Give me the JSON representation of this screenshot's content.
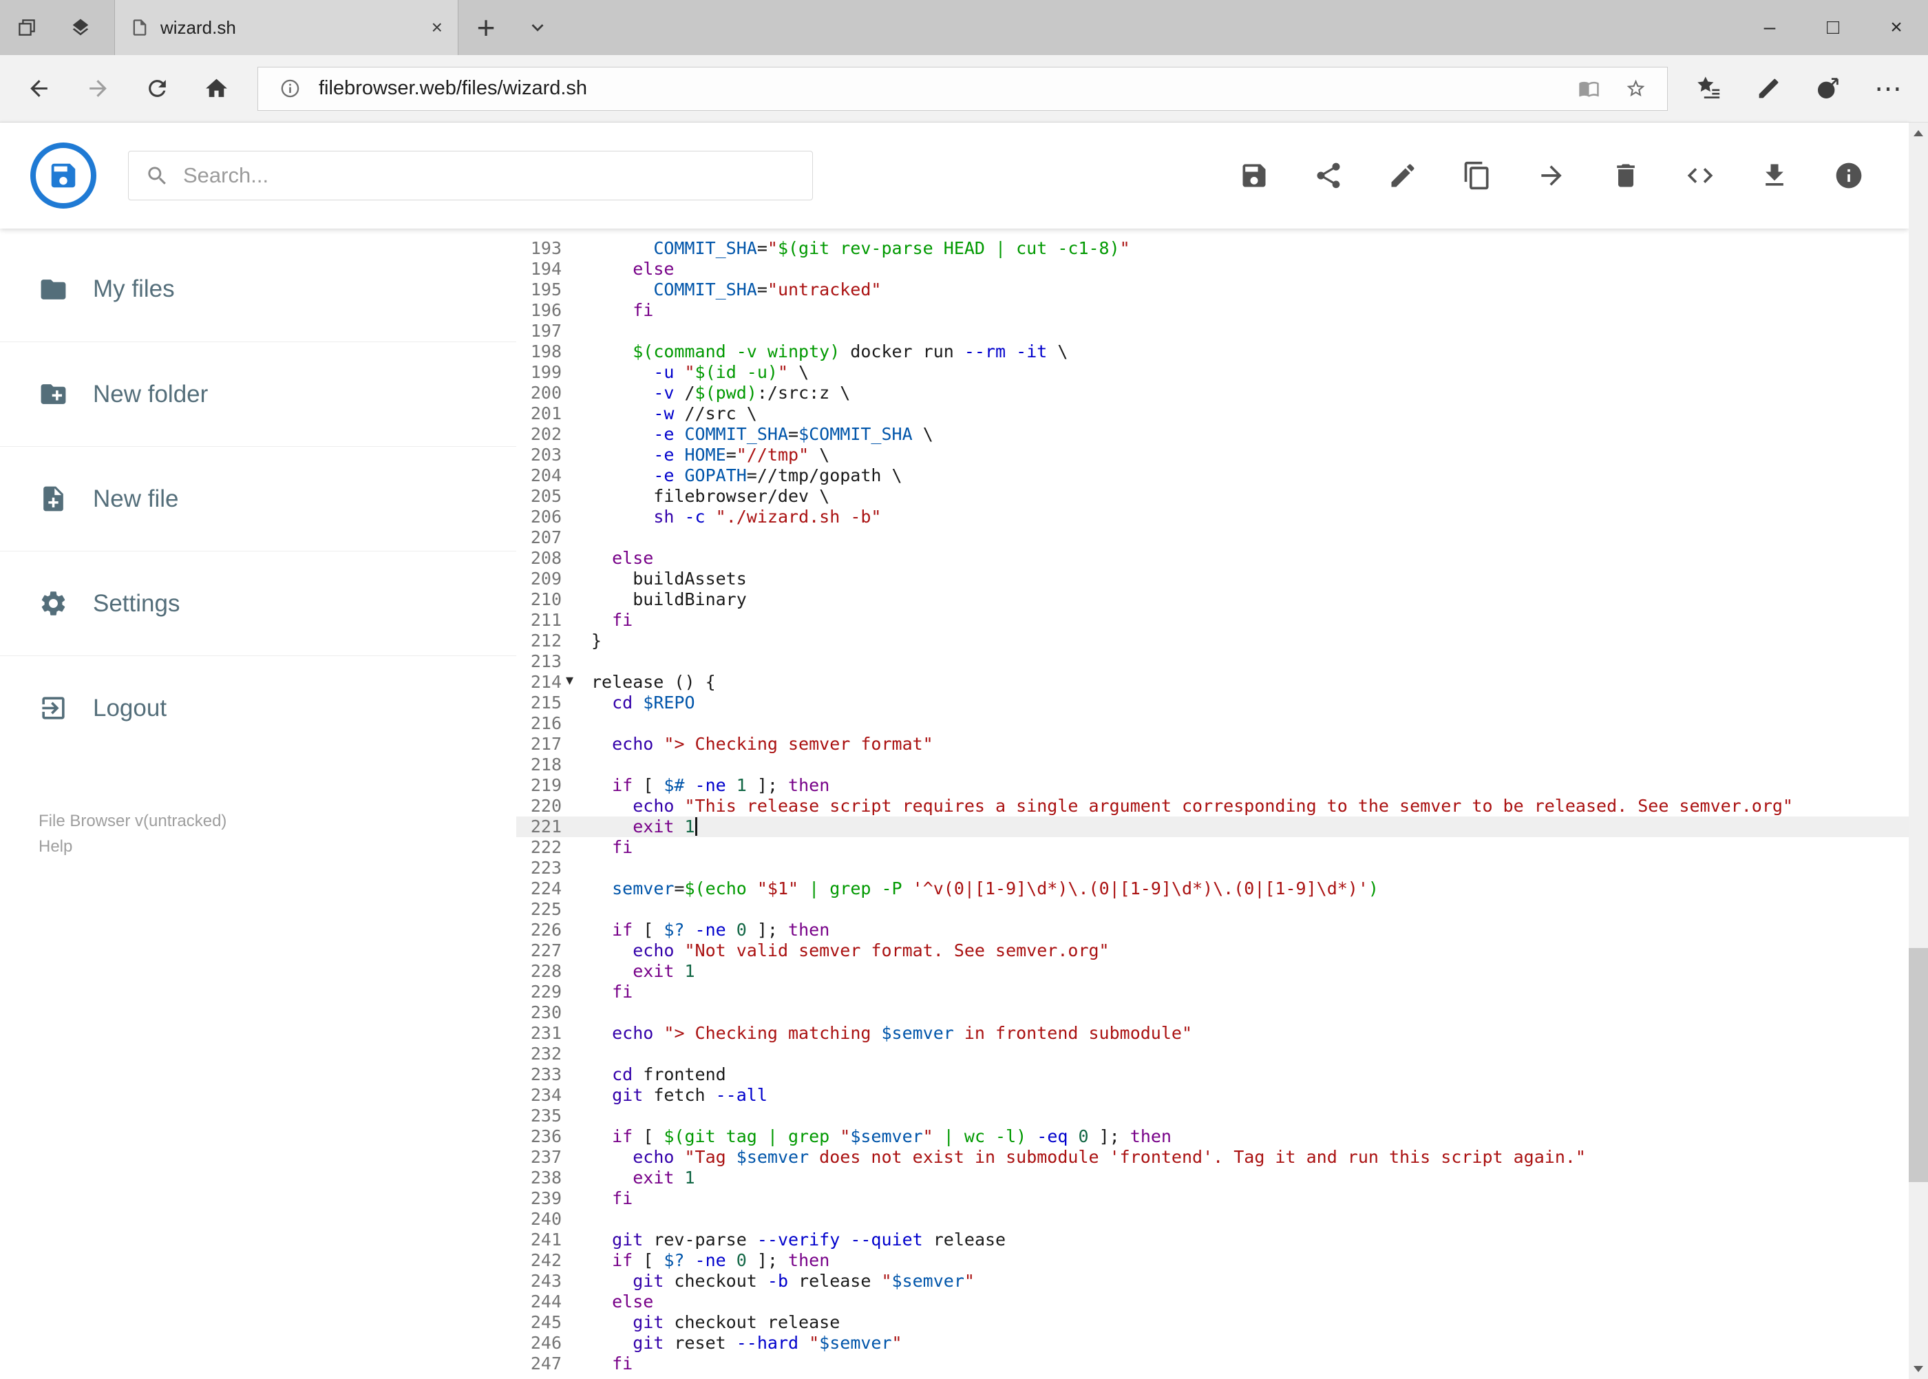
{
  "icons": {
    "close": "×",
    "plus": "+",
    "more": "⋯",
    "minimize": "–",
    "maximize": "□",
    "fold": "▾"
  },
  "browser": {
    "tab": {
      "title": "wizard.sh"
    },
    "address": {
      "host": "filebrowser.web",
      "path": "/files/wizard.sh"
    }
  },
  "app": {
    "search_placeholder": "Search...",
    "sidebar": {
      "items": [
        {
          "label": "My files"
        },
        {
          "label": "New folder"
        },
        {
          "label": "New file"
        },
        {
          "label": "Settings"
        },
        {
          "label": "Logout"
        }
      ],
      "footer_version": "File Browser v(untracked)",
      "footer_help": "Help"
    }
  },
  "editor": {
    "active_line": 221,
    "cursor_line": 221,
    "fold_line": 214,
    "colors": {
      "keyword": "#770088",
      "builtin": "#3300aa",
      "variable": "#0055aa",
      "string": "#aa1111",
      "substitution": "#009900",
      "number": "#116644",
      "flag": "#0000cc"
    },
    "lines": [
      {
        "n": 193,
        "s": [
          [
            "p",
            "      "
          ],
          [
            "d",
            "COMMIT_SHA"
          ],
          [
            "p",
            "="
          ],
          [
            "s",
            "\""
          ],
          [
            "q",
            "$(git rev-parse HEAD | cut -c1-8)"
          ],
          [
            "s",
            "\""
          ]
        ]
      },
      {
        "n": 194,
        "s": [
          [
            "p",
            "    "
          ],
          [
            "k",
            "else"
          ]
        ]
      },
      {
        "n": 195,
        "s": [
          [
            "p",
            "      "
          ],
          [
            "d",
            "COMMIT_SHA"
          ],
          [
            "p",
            "="
          ],
          [
            "s",
            "\"untracked\""
          ]
        ]
      },
      {
        "n": 196,
        "s": [
          [
            "p",
            "    "
          ],
          [
            "k",
            "fi"
          ]
        ]
      },
      {
        "n": 197,
        "s": []
      },
      {
        "n": 198,
        "s": [
          [
            "p",
            "    "
          ],
          [
            "q",
            "$(command -v winpty)"
          ],
          [
            "p",
            " docker run "
          ],
          [
            "a",
            "--rm"
          ],
          [
            "p",
            " "
          ],
          [
            "a",
            "-it"
          ],
          [
            "p",
            " \\"
          ]
        ]
      },
      {
        "n": 199,
        "s": [
          [
            "p",
            "      "
          ],
          [
            "a",
            "-u"
          ],
          [
            "p",
            " "
          ],
          [
            "s",
            "\""
          ],
          [
            "q",
            "$(id -u)"
          ],
          [
            "s",
            "\""
          ],
          [
            "p",
            " \\"
          ]
        ]
      },
      {
        "n": 200,
        "s": [
          [
            "p",
            "      "
          ],
          [
            "a",
            "-v"
          ],
          [
            "p",
            " /"
          ],
          [
            "q",
            "$(pwd)"
          ],
          [
            "p",
            ":/src:z \\"
          ]
        ]
      },
      {
        "n": 201,
        "s": [
          [
            "p",
            "      "
          ],
          [
            "a",
            "-w"
          ],
          [
            "p",
            " //src \\"
          ]
        ]
      },
      {
        "n": 202,
        "s": [
          [
            "p",
            "      "
          ],
          [
            "a",
            "-e"
          ],
          [
            "p",
            " "
          ],
          [
            "d",
            "COMMIT_SHA"
          ],
          [
            "p",
            "="
          ],
          [
            "d",
            "$COMMIT_SHA"
          ],
          [
            "p",
            " \\"
          ]
        ]
      },
      {
        "n": 203,
        "s": [
          [
            "p",
            "      "
          ],
          [
            "a",
            "-e"
          ],
          [
            "p",
            " "
          ],
          [
            "d",
            "HOME"
          ],
          [
            "p",
            "="
          ],
          [
            "s",
            "\"//tmp\""
          ],
          [
            "p",
            " \\"
          ]
        ]
      },
      {
        "n": 204,
        "s": [
          [
            "p",
            "      "
          ],
          [
            "a",
            "-e"
          ],
          [
            "p",
            " "
          ],
          [
            "d",
            "GOPATH"
          ],
          [
            "p",
            "=//tmp/gopath \\"
          ]
        ]
      },
      {
        "n": 205,
        "s": [
          [
            "p",
            "      filebrowser/dev \\"
          ]
        ]
      },
      {
        "n": 206,
        "s": [
          [
            "p",
            "      "
          ],
          [
            "b",
            "sh"
          ],
          [
            "p",
            " "
          ],
          [
            "a",
            "-c"
          ],
          [
            "p",
            " "
          ],
          [
            "s",
            "\"./wizard.sh -b\""
          ]
        ]
      },
      {
        "n": 207,
        "s": []
      },
      {
        "n": 208,
        "s": [
          [
            "p",
            "  "
          ],
          [
            "k",
            "else"
          ]
        ]
      },
      {
        "n": 209,
        "s": [
          [
            "p",
            "    buildAssets"
          ]
        ]
      },
      {
        "n": 210,
        "s": [
          [
            "p",
            "    buildBinary"
          ]
        ]
      },
      {
        "n": 211,
        "s": [
          [
            "p",
            "  "
          ],
          [
            "k",
            "fi"
          ]
        ]
      },
      {
        "n": 212,
        "s": [
          [
            "p",
            "}"
          ]
        ]
      },
      {
        "n": 213,
        "s": []
      },
      {
        "n": 214,
        "s": [
          [
            "p",
            "release () {"
          ]
        ]
      },
      {
        "n": 215,
        "s": [
          [
            "p",
            "  "
          ],
          [
            "b",
            "cd"
          ],
          [
            "p",
            " "
          ],
          [
            "d",
            "$REPO"
          ]
        ]
      },
      {
        "n": 216,
        "s": []
      },
      {
        "n": 217,
        "s": [
          [
            "p",
            "  "
          ],
          [
            "b",
            "echo"
          ],
          [
            "p",
            " "
          ],
          [
            "s",
            "\"> Checking semver format\""
          ]
        ]
      },
      {
        "n": 218,
        "s": []
      },
      {
        "n": 219,
        "s": [
          [
            "p",
            "  "
          ],
          [
            "k",
            "if"
          ],
          [
            "p",
            " [ "
          ],
          [
            "d",
            "$#"
          ],
          [
            "p",
            " "
          ],
          [
            "a",
            "-ne"
          ],
          [
            "p",
            " "
          ],
          [
            "m",
            "1"
          ],
          [
            "p",
            " ]; "
          ],
          [
            "k",
            "then"
          ]
        ]
      },
      {
        "n": 220,
        "s": [
          [
            "p",
            "    "
          ],
          [
            "b",
            "echo"
          ],
          [
            "p",
            " "
          ],
          [
            "s",
            "\"This release script requires a single argument corresponding to the semver to be released. See semver.org\""
          ]
        ]
      },
      {
        "n": 221,
        "s": [
          [
            "p",
            "    "
          ],
          [
            "k",
            "exit"
          ],
          [
            "p",
            " "
          ],
          [
            "m",
            "1"
          ]
        ]
      },
      {
        "n": 222,
        "s": [
          [
            "p",
            "  "
          ],
          [
            "k",
            "fi"
          ]
        ]
      },
      {
        "n": 223,
        "s": []
      },
      {
        "n": 224,
        "s": [
          [
            "p",
            "  "
          ],
          [
            "d",
            "semver"
          ],
          [
            "p",
            "="
          ],
          [
            "q",
            "$(echo "
          ],
          [
            "s",
            "\"$1\""
          ],
          [
            "q",
            " | grep -P "
          ],
          [
            "s",
            "'^v(0|[1-9]\\d*)\\.(0|[1-9]\\d*)\\.(0|[1-9]\\d*)'"
          ],
          [
            "q",
            ")"
          ]
        ]
      },
      {
        "n": 225,
        "s": []
      },
      {
        "n": 226,
        "s": [
          [
            "p",
            "  "
          ],
          [
            "k",
            "if"
          ],
          [
            "p",
            " [ "
          ],
          [
            "d",
            "$?"
          ],
          [
            "p",
            " "
          ],
          [
            "a",
            "-ne"
          ],
          [
            "p",
            " "
          ],
          [
            "m",
            "0"
          ],
          [
            "p",
            " ]; "
          ],
          [
            "k",
            "then"
          ]
        ]
      },
      {
        "n": 227,
        "s": [
          [
            "p",
            "    "
          ],
          [
            "b",
            "echo"
          ],
          [
            "p",
            " "
          ],
          [
            "s",
            "\"Not valid semver format. See semver.org\""
          ]
        ]
      },
      {
        "n": 228,
        "s": [
          [
            "p",
            "    "
          ],
          [
            "k",
            "exit"
          ],
          [
            "p",
            " "
          ],
          [
            "m",
            "1"
          ]
        ]
      },
      {
        "n": 229,
        "s": [
          [
            "p",
            "  "
          ],
          [
            "k",
            "fi"
          ]
        ]
      },
      {
        "n": 230,
        "s": []
      },
      {
        "n": 231,
        "s": [
          [
            "p",
            "  "
          ],
          [
            "b",
            "echo"
          ],
          [
            "p",
            " "
          ],
          [
            "s",
            "\"> Checking matching "
          ],
          [
            "d",
            "$semver"
          ],
          [
            "s",
            " in frontend submodule\""
          ]
        ]
      },
      {
        "n": 232,
        "s": []
      },
      {
        "n": 233,
        "s": [
          [
            "p",
            "  "
          ],
          [
            "b",
            "cd"
          ],
          [
            "p",
            " frontend"
          ]
        ]
      },
      {
        "n": 234,
        "s": [
          [
            "p",
            "  "
          ],
          [
            "b",
            "git"
          ],
          [
            "p",
            " fetch "
          ],
          [
            "a",
            "--all"
          ]
        ]
      },
      {
        "n": 235,
        "s": []
      },
      {
        "n": 236,
        "s": [
          [
            "p",
            "  "
          ],
          [
            "k",
            "if"
          ],
          [
            "p",
            " [ "
          ],
          [
            "q",
            "$(git tag | grep "
          ],
          [
            "s",
            "\""
          ],
          [
            "d",
            "$semver"
          ],
          [
            "s",
            "\""
          ],
          [
            "q",
            " | wc -l)"
          ],
          [
            "p",
            " "
          ],
          [
            "a",
            "-eq"
          ],
          [
            "p",
            " "
          ],
          [
            "m",
            "0"
          ],
          [
            "p",
            " ]; "
          ],
          [
            "k",
            "then"
          ]
        ]
      },
      {
        "n": 237,
        "s": [
          [
            "p",
            "    "
          ],
          [
            "b",
            "echo"
          ],
          [
            "p",
            " "
          ],
          [
            "s",
            "\"Tag "
          ],
          [
            "d",
            "$semver"
          ],
          [
            "s",
            " does not exist in submodule 'frontend'. Tag it and run this script again.\""
          ]
        ]
      },
      {
        "n": 238,
        "s": [
          [
            "p",
            "    "
          ],
          [
            "k",
            "exit"
          ],
          [
            "p",
            " "
          ],
          [
            "m",
            "1"
          ]
        ]
      },
      {
        "n": 239,
        "s": [
          [
            "p",
            "  "
          ],
          [
            "k",
            "fi"
          ]
        ]
      },
      {
        "n": 240,
        "s": []
      },
      {
        "n": 241,
        "s": [
          [
            "p",
            "  "
          ],
          [
            "b",
            "git"
          ],
          [
            "p",
            " rev-parse "
          ],
          [
            "a",
            "--verify"
          ],
          [
            "p",
            " "
          ],
          [
            "a",
            "--quiet"
          ],
          [
            "p",
            " release"
          ]
        ]
      },
      {
        "n": 242,
        "s": [
          [
            "p",
            "  "
          ],
          [
            "k",
            "if"
          ],
          [
            "p",
            " [ "
          ],
          [
            "d",
            "$?"
          ],
          [
            "p",
            " "
          ],
          [
            "a",
            "-ne"
          ],
          [
            "p",
            " "
          ],
          [
            "m",
            "0"
          ],
          [
            "p",
            " ]; "
          ],
          [
            "k",
            "then"
          ]
        ]
      },
      {
        "n": 243,
        "s": [
          [
            "p",
            "    "
          ],
          [
            "b",
            "git"
          ],
          [
            "p",
            " checkout "
          ],
          [
            "a",
            "-b"
          ],
          [
            "p",
            " release "
          ],
          [
            "s",
            "\""
          ],
          [
            "d",
            "$semver"
          ],
          [
            "s",
            "\""
          ]
        ]
      },
      {
        "n": 244,
        "s": [
          [
            "p",
            "  "
          ],
          [
            "k",
            "else"
          ]
        ]
      },
      {
        "n": 245,
        "s": [
          [
            "p",
            "    "
          ],
          [
            "b",
            "git"
          ],
          [
            "p",
            " checkout release"
          ]
        ]
      },
      {
        "n": 246,
        "s": [
          [
            "p",
            "    "
          ],
          [
            "b",
            "git"
          ],
          [
            "p",
            " reset "
          ],
          [
            "a",
            "--hard"
          ],
          [
            "p",
            " "
          ],
          [
            "s",
            "\""
          ],
          [
            "d",
            "$semver"
          ],
          [
            "s",
            "\""
          ]
        ]
      },
      {
        "n": 247,
        "s": [
          [
            "p",
            "  "
          ],
          [
            "k",
            "fi"
          ]
        ]
      }
    ]
  }
}
